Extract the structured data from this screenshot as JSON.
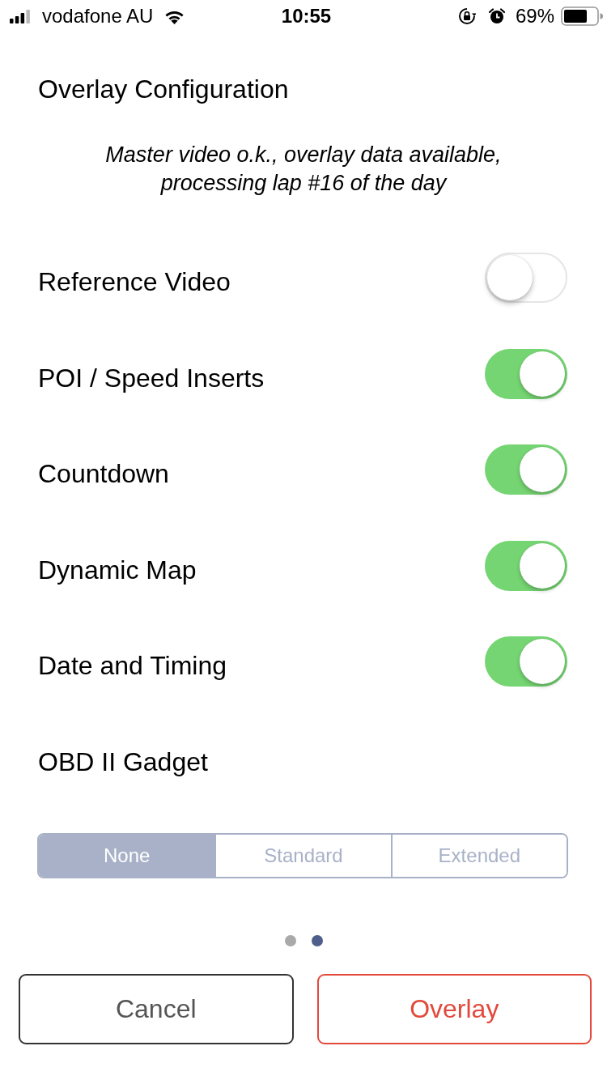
{
  "status_bar": {
    "carrier": "vodafone AU",
    "time": "10:55",
    "battery": "69%"
  },
  "title": "Overlay Configuration",
  "status_message": "Master video o.k., overlay data available,\nprocessing lap #16 of the day",
  "settings": [
    {
      "label": "Reference Video",
      "kind": "toggle",
      "on": false
    },
    {
      "label": "POI / Speed Inserts",
      "kind": "toggle",
      "on": true
    },
    {
      "label": "Countdown",
      "kind": "toggle",
      "on": true
    },
    {
      "label": "Dynamic Map",
      "kind": "toggle",
      "on": true
    },
    {
      "label": "Date and Timing",
      "kind": "toggle",
      "on": true
    },
    {
      "label": "OBD II Gadget",
      "kind": "segmented",
      "options": [
        {
          "label": "None",
          "selected": true
        },
        {
          "label": "Standard",
          "selected": false
        },
        {
          "label": "Extended",
          "selected": false
        }
      ]
    }
  ],
  "pager": [
    {
      "selected": false
    },
    {
      "selected": true
    }
  ],
  "buttons": [
    {
      "label": "Cancel",
      "kind": "secondary"
    },
    {
      "label": "Overlay",
      "kind": "primary"
    }
  ]
}
